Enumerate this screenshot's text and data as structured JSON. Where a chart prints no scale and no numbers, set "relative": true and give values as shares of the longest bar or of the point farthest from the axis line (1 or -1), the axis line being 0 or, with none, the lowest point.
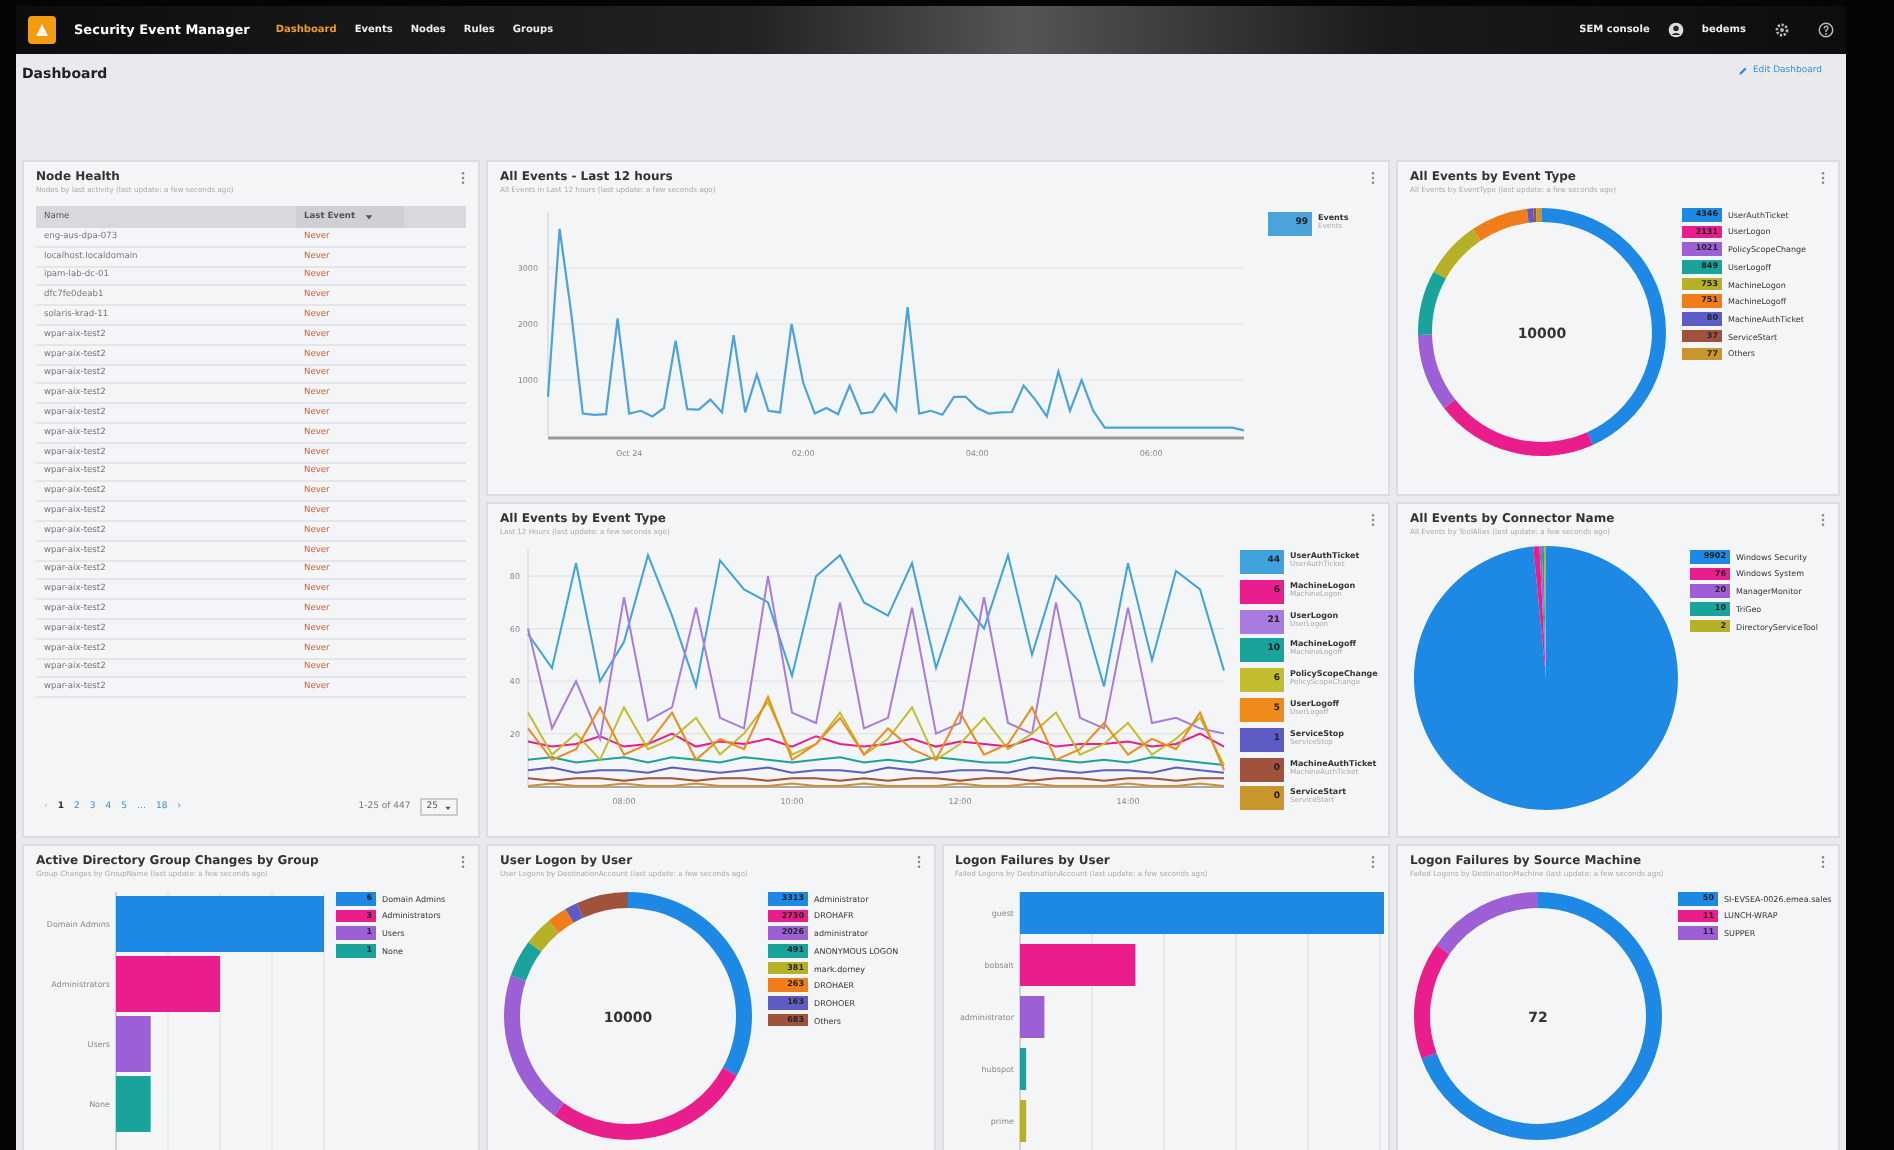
{
  "topbar": {
    "app_name": "Security Event Manager",
    "nav": [
      {
        "label": "Dashboard",
        "selected": true
      },
      {
        "label": "Events",
        "selected": false
      },
      {
        "label": "Nodes",
        "selected": false
      },
      {
        "label": "Rules",
        "selected": false
      },
      {
        "label": "Groups",
        "selected": false
      }
    ],
    "console": "SEM console",
    "user": "bedems"
  },
  "page": {
    "title": "Dashboard",
    "edit_link": "Edit Dashboard"
  },
  "node_health": {
    "title": "Node Health",
    "subtitle": "Nodes by last activity (last update: a few seconds ago)",
    "columns": [
      "Name",
      "Last Event"
    ],
    "rows": [
      {
        "name": "eng-aus-dpa-073",
        "last_event": "Never"
      },
      {
        "name": "localhost.localdomain",
        "last_event": "Never"
      },
      {
        "name": "ipam-lab-dc-01",
        "last_event": "Never"
      },
      {
        "name": "dfc7fe0deab1",
        "last_event": "Never"
      },
      {
        "name": "solaris-krad-11",
        "last_event": "Never"
      },
      {
        "name": "wpar-aix-test2",
        "last_event": "Never"
      },
      {
        "name": "wpar-aix-test2",
        "last_event": "Never"
      },
      {
        "name": "wpar-aix-test2",
        "last_event": "Never"
      },
      {
        "name": "wpar-aix-test2",
        "last_event": "Never"
      },
      {
        "name": "wpar-aix-test2",
        "last_event": "Never"
      },
      {
        "name": "wpar-aix-test2",
        "last_event": "Never"
      },
      {
        "name": "wpar-aix-test2",
        "last_event": "Never"
      },
      {
        "name": "wpar-aix-test2",
        "last_event": "Never"
      },
      {
        "name": "wpar-aix-test2",
        "last_event": "Never"
      },
      {
        "name": "wpar-aix-test2",
        "last_event": "Never"
      },
      {
        "name": "wpar-aix-test2",
        "last_event": "Never"
      },
      {
        "name": "wpar-aix-test2",
        "last_event": "Never"
      },
      {
        "name": "wpar-aix-test2",
        "last_event": "Never"
      },
      {
        "name": "wpar-aix-test2",
        "last_event": "Never"
      },
      {
        "name": "wpar-aix-test2",
        "last_event": "Never"
      },
      {
        "name": "wpar-aix-test2",
        "last_event": "Never"
      },
      {
        "name": "wpar-aix-test2",
        "last_event": "Never"
      },
      {
        "name": "wpar-aix-test2",
        "last_event": "Never"
      },
      {
        "name": "wpar-aix-test2",
        "last_event": "Never"
      }
    ],
    "pagination": {
      "prev": "‹",
      "next": "›",
      "pages": [
        {
          "label": "1",
          "selected": true
        },
        {
          "label": "2",
          "selected": false
        },
        {
          "label": "3",
          "selected": false
        },
        {
          "label": "4",
          "selected": false
        },
        {
          "label": "5",
          "selected": false
        },
        {
          "label": "…",
          "selected": false
        },
        {
          "label": "18",
          "selected": false
        }
      ],
      "range": "1-25 of 447",
      "per_page": "25"
    }
  },
  "events_12h": {
    "title": "All Events - Last 12 hours",
    "subtitle": "All Events in Last 12 hours (last update: a few seconds ago)",
    "chart_data": {
      "type": "line",
      "grid": true,
      "ylim": [
        0,
        4000
      ],
      "yticks": [
        1000,
        2000,
        3000
      ],
      "categories": [
        null,
        null,
        null,
        null,
        null,
        null,
        null,
        "Oct 24",
        null,
        null,
        null,
        null,
        null,
        null,
        null,
        null,
        null,
        null,
        null,
        null,
        null,
        null,
        "02:00",
        null,
        null,
        null,
        null,
        null,
        null,
        null,
        null,
        null,
        null,
        null,
        null,
        null,
        null,
        "04:00",
        null,
        null,
        null,
        null,
        null,
        null,
        null,
        null,
        null,
        null,
        null,
        null,
        null,
        null,
        "06:00",
        null,
        null,
        null,
        null,
        null,
        null,
        null,
        null
      ],
      "series": [
        {
          "name": "Events",
          "color": "#4ba3dc",
          "values": [
            700,
            3700,
            2200,
            400,
            380,
            390,
            2100,
            400,
            450,
            350,
            500,
            1700,
            480,
            470,
            650,
            420,
            1800,
            420,
            1100,
            450,
            420,
            2000,
            950,
            400,
            500,
            390,
            900,
            400,
            430,
            750,
            450,
            2300,
            400,
            450,
            380,
            700,
            700,
            500,
            400,
            420,
            430,
            900,
            650,
            350,
            1150,
            450,
            1000,
            450,
            150,
            150,
            150,
            150,
            150,
            150,
            150,
            150,
            150,
            150,
            150,
            150,
            100
          ]
        }
      ]
    },
    "legend": {
      "value": "99",
      "sublabel": "Events"
    }
  },
  "events_by_type": {
    "title": "All Events by Event Type",
    "subtitle": "All Events by EventType (last update: a few seconds ago)",
    "center": "10000",
    "chart_data": {
      "type": "donut",
      "categories": [
        "UserAuthTicket",
        "UserLogon",
        "PolicyScopeChange",
        "UserLogoff",
        "MachineLogon",
        "MachineLogoff",
        "MachineAuthTicket",
        "ServiceStart",
        "Others"
      ],
      "values": [
        43.26,
        21.21,
        10.16,
        8.45,
        7.5,
        7.48,
        0.8,
        0.37,
        0.77
      ],
      "colors": [
        "#1e88e5",
        "#e91e8c",
        "#9c5fd6",
        "#1aa39a",
        "#b5b025",
        "#f07d1a",
        "#5c5cc4",
        "#a0523c",
        "#c8962d"
      ]
    },
    "legend": [
      "4346",
      "2131",
      "1021",
      "849",
      "753",
      "751",
      "80",
      "37",
      "77"
    ]
  },
  "events_timeline": {
    "title": "All Events by Event Type",
    "subtitle": "Last 12 Hours (last update: a few seconds ago)",
    "chart_data": {
      "type": "line",
      "grid": true,
      "ylim": [
        0,
        90
      ],
      "yticks": [
        20,
        40,
        60,
        80
      ],
      "categories": [
        null,
        null,
        null,
        null,
        "08:00",
        null,
        null,
        null,
        null,
        null,
        null,
        "10:00",
        null,
        null,
        null,
        null,
        null,
        null,
        "12:00",
        null,
        null,
        null,
        null,
        null,
        null,
        "14:00",
        null,
        null,
        null,
        null
      ],
      "series": [
        {
          "name": "UserAuthTicket",
          "color": "#3fa2dd",
          "values": [
            58,
            45,
            85,
            40,
            55,
            88,
            65,
            38,
            86,
            75,
            70,
            42,
            80,
            88,
            70,
            65,
            85,
            45,
            72,
            60,
            88,
            50,
            80,
            70,
            38,
            85,
            48,
            82,
            75,
            44
          ]
        },
        {
          "name": "MachineLogon",
          "color": "#e91e8c",
          "values": [
            17,
            15,
            16,
            19,
            15,
            16,
            20,
            15,
            17,
            16,
            18,
            15,
            19,
            16,
            15,
            16,
            18,
            15,
            17,
            16,
            15,
            18,
            15,
            16,
            16,
            17,
            15,
            16,
            20,
            15
          ]
        },
        {
          "name": "UserLogon",
          "color": "#a77be0",
          "values": [
            60,
            22,
            40,
            18,
            72,
            25,
            30,
            68,
            26,
            22,
            80,
            28,
            24,
            70,
            22,
            26,
            68,
            20,
            24,
            72,
            24,
            20,
            70,
            26,
            22,
            68,
            24,
            26,
            22,
            20
          ]
        },
        {
          "name": "MachineLogoff",
          "color": "#1aa39a",
          "values": [
            10,
            11,
            9,
            10,
            11,
            9,
            11,
            10,
            9,
            11,
            10,
            9,
            10,
            11,
            9,
            10,
            9,
            11,
            10,
            9,
            9,
            11,
            10,
            9,
            10,
            9,
            11,
            10,
            9,
            8
          ]
        },
        {
          "name": "PolicyScopeChange",
          "color": "#c2bd2e",
          "values": [
            28,
            12,
            20,
            10,
            30,
            14,
            18,
            26,
            12,
            20,
            32,
            12,
            16,
            28,
            12,
            18,
            30,
            10,
            16,
            26,
            14,
            20,
            28,
            12,
            16,
            24,
            12,
            18,
            26,
            8
          ]
        },
        {
          "name": "UserLogoff",
          "color": "#f08a1a",
          "values": [
            22,
            10,
            14,
            30,
            12,
            16,
            28,
            10,
            18,
            14,
            34,
            10,
            16,
            26,
            12,
            22,
            14,
            10,
            28,
            12,
            16,
            30,
            10,
            14,
            24,
            12,
            18,
            14,
            28,
            6
          ]
        },
        {
          "name": "ServiceStop",
          "color": "#5c5cc4",
          "values": [
            6,
            7,
            5,
            6,
            6,
            5,
            7,
            6,
            5,
            6,
            7,
            5,
            6,
            6,
            5,
            7,
            6,
            5,
            6,
            6,
            5,
            7,
            6,
            5,
            6,
            6,
            5,
            7,
            6,
            5
          ]
        },
        {
          "name": "MachineAuthTicket",
          "color": "#a0523c",
          "values": [
            3,
            2,
            3,
            3,
            2,
            3,
            3,
            2,
            3,
            3,
            2,
            3,
            3,
            2,
            3,
            2,
            3,
            3,
            2,
            3,
            3,
            2,
            3,
            3,
            2,
            3,
            3,
            2,
            3,
            3
          ]
        },
        {
          "name": "ServiceStart",
          "color": "#c8962d",
          "values": [
            0,
            1,
            0,
            0,
            1,
            0,
            0,
            1,
            0,
            0,
            0,
            1,
            0,
            0,
            1,
            0,
            0,
            0,
            1,
            0,
            0,
            1,
            0,
            0,
            0,
            1,
            0,
            0,
            1,
            0
          ]
        }
      ]
    },
    "legend": [
      {
        "value": "44",
        "sublabel": "UserAuthTicket"
      },
      {
        "value": "6",
        "sublabel": "MachineLogon"
      },
      {
        "value": "21",
        "sublabel": "UserLogon"
      },
      {
        "value": "10",
        "sublabel": "MachineLogoff"
      },
      {
        "value": "6",
        "sublabel": "PolicyScopeChange"
      },
      {
        "value": "5",
        "sublabel": "UserLogoff"
      },
      {
        "value": "1",
        "sublabel": "ServiceStop"
      },
      {
        "value": "0",
        "sublabel": "MachineAuthTicket"
      },
      {
        "value": "0",
        "sublabel": "ServiceStart"
      }
    ]
  },
  "connector": {
    "title": "All Events by Connector Name",
    "subtitle": "All Events by ToolAlias (last update: a few seconds ago)",
    "chart_data": {
      "type": "pie",
      "categories": [
        "Windows Security",
        "Windows System",
        "ManagerMonitor",
        "TriGeo",
        "DirectoryServiceTool"
      ],
      "values": [
        98.92,
        0.76,
        0.2,
        0.1,
        0.02
      ],
      "colors": [
        "#1e88e5",
        "#e91e8c",
        "#9c5fd6",
        "#1aa39a",
        "#b5b025"
      ]
    },
    "legend": [
      "9902",
      "76",
      "20",
      "10",
      "2"
    ]
  },
  "ad_groups": {
    "title": "Active Directory Group Changes by Group",
    "subtitle": "Group Changes by GroupName (last update: a few seconds ago)",
    "chart_data": {
      "type": "bar",
      "orientation": "horizontal",
      "grid": true,
      "relative": true,
      "categories": [
        "Domain Admins",
        "Administrators",
        "Users",
        "None"
      ],
      "values": [
        1,
        0.5,
        0.1667,
        0.1667
      ],
      "colors": [
        "#1e88e5",
        "#e91e8c",
        "#9c5fd6",
        "#1aa39a"
      ]
    },
    "legend": [
      "6",
      "3",
      "1",
      "1"
    ]
  },
  "user_logon": {
    "title": "User Logon by User",
    "subtitle": "User Logons by DestinationAccount (last update: a few seconds ago)",
    "center": "10000",
    "chart_data": {
      "type": "donut",
      "categories": [
        "Administrator",
        "DROHAFR",
        "administrator",
        "ANONYMOUS LOGON",
        "mark.dorney",
        "DROHAER",
        "DROHOER",
        "Others"
      ],
      "values": [
        32.96,
        27.16,
        20.16,
        4.89,
        3.79,
        2.62,
        1.62,
        6.8
      ],
      "colors": [
        "#1e88e5",
        "#e91e8c",
        "#9c5fd6",
        "#1aa39a",
        "#b5b025",
        "#f07d1a",
        "#5c5cc4",
        "#a0523c"
      ]
    },
    "legend": [
      "3313",
      "2730",
      "2026",
      "491",
      "381",
      "263",
      "163",
      "683"
    ]
  },
  "logon_failures_user": {
    "title": "Logon Failures by User",
    "subtitle": "Failed Logons by DestinationAccount (last update: a few seconds ago)",
    "chart_data": {
      "type": "bar",
      "orientation": "horizontal",
      "grid": true,
      "relative": true,
      "categories": [
        "guest",
        "bobsalt",
        "administrator",
        "hubspot",
        "prime"
      ],
      "values": [
        1,
        0.317,
        0.067,
        0.017,
        0.017
      ],
      "colors": [
        "#1e88e5",
        "#e91e8c",
        "#9c5fd6",
        "#1aa39a",
        "#b5b025"
      ]
    }
  },
  "logon_failures_machine": {
    "title": "Logon Failures by Source Machine",
    "subtitle": "Failed Logons by DestinationMachine (last update: a few seconds ago)",
    "center": "72",
    "chart_data": {
      "type": "donut",
      "categories": [
        "SI-EVSEA-0026.emea.sales",
        "LUNCH-WRAP",
        "SUPPER"
      ],
      "values": [
        69.44,
        15.28,
        15.28
      ],
      "colors": [
        "#1e88e5",
        "#e91e8c",
        "#9c5fd6"
      ]
    },
    "legend": [
      "50",
      "11",
      "11"
    ]
  }
}
